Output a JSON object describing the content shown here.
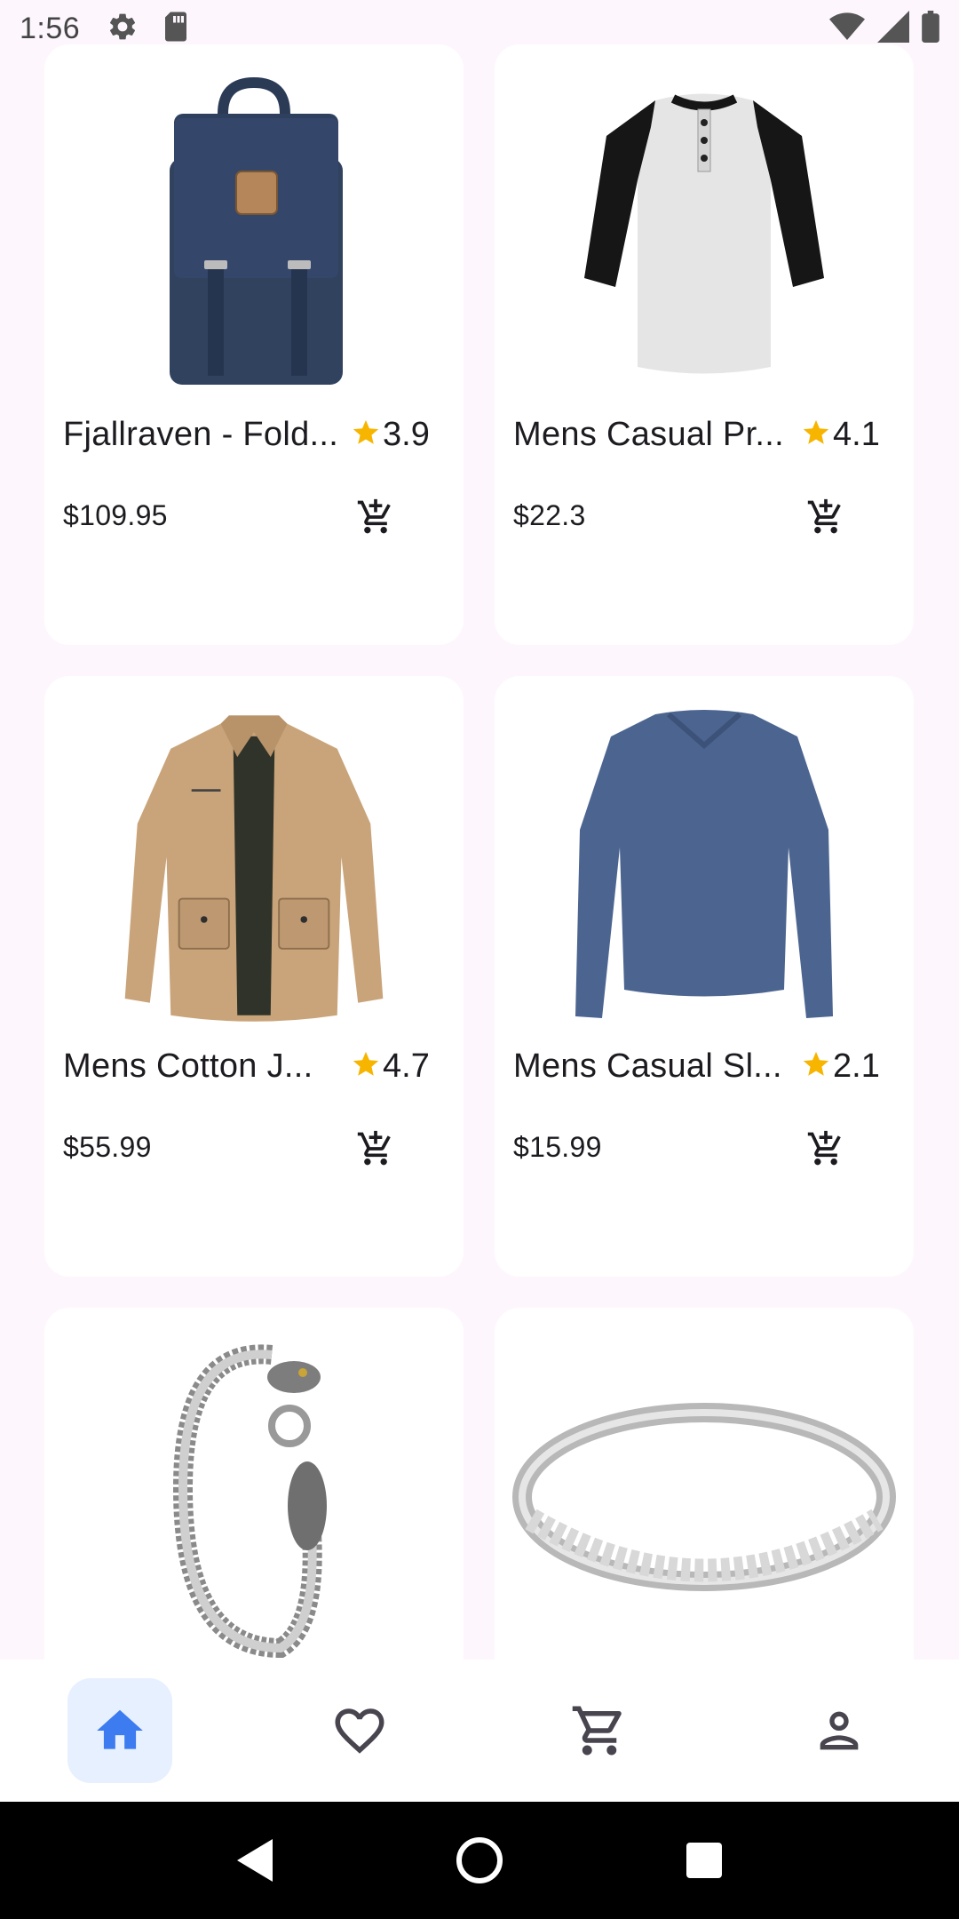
{
  "status_bar": {
    "time": "1:56",
    "icons": [
      "gear-icon",
      "sd-card-icon",
      "wifi-icon",
      "cellular-signal-icon",
      "battery-icon"
    ]
  },
  "products": [
    {
      "title": "Fjallraven - Fold...",
      "rating": "3.9",
      "price": "$109.95",
      "image": "navy-backpack"
    },
    {
      "title": "Mens Casual Pr...",
      "rating": "4.1",
      "price": "$22.3",
      "image": "raglan-henley-shirt"
    },
    {
      "title": "Mens Cotton J...",
      "rating": "4.7",
      "price": "$55.99",
      "image": "khaki-cotton-jacket"
    },
    {
      "title": "Mens Casual Sl...",
      "rating": "2.1",
      "price": "$15.99",
      "image": "blue-long-sleeve-tee"
    },
    {
      "title": "",
      "rating": "",
      "price": "",
      "image": "dragon-chain-bracelet"
    },
    {
      "title": "",
      "rating": "",
      "price": "",
      "image": "silver-diamond-ring"
    }
  ],
  "bottom_nav": {
    "items": [
      "home-icon",
      "heart-icon",
      "cart-icon",
      "person-icon"
    ],
    "active": "home-icon"
  },
  "colors": {
    "background": "#fdf7fd",
    "card": "#ffffff",
    "star": "#f7b500",
    "nav_active": "#3d7bf0",
    "nav_active_bg": "#e7f0fe",
    "icon_gray": "#49454f"
  }
}
